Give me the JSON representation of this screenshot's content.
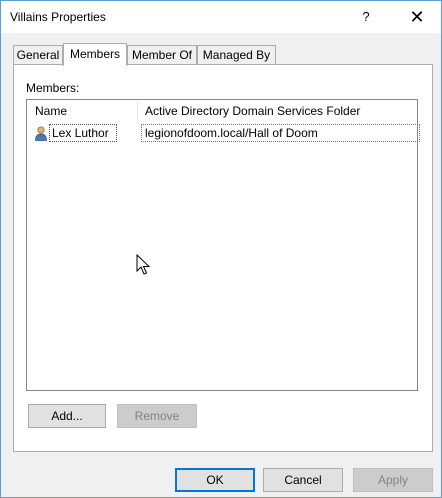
{
  "window": {
    "title": "Villains Properties",
    "help_label": "?",
    "close_label": "✕"
  },
  "tabs": [
    "General",
    "Members",
    "Member Of",
    "Managed By"
  ],
  "panel": {
    "members_label": "Members:",
    "columns": [
      "Name",
      "Active Directory Domain Services Folder"
    ],
    "rows": [
      {
        "name": "Lex Luthor",
        "folder": "legionofdoom.local/Hall of Doom",
        "icon": "user-icon"
      }
    ],
    "add_label": "Add...",
    "remove_label": "Remove"
  },
  "footer": {
    "ok_label": "OK",
    "cancel_label": "Cancel",
    "apply_label": "Apply"
  },
  "colors": {
    "default_button_border": "#0078d7",
    "window_border": "#5a9fd4"
  }
}
